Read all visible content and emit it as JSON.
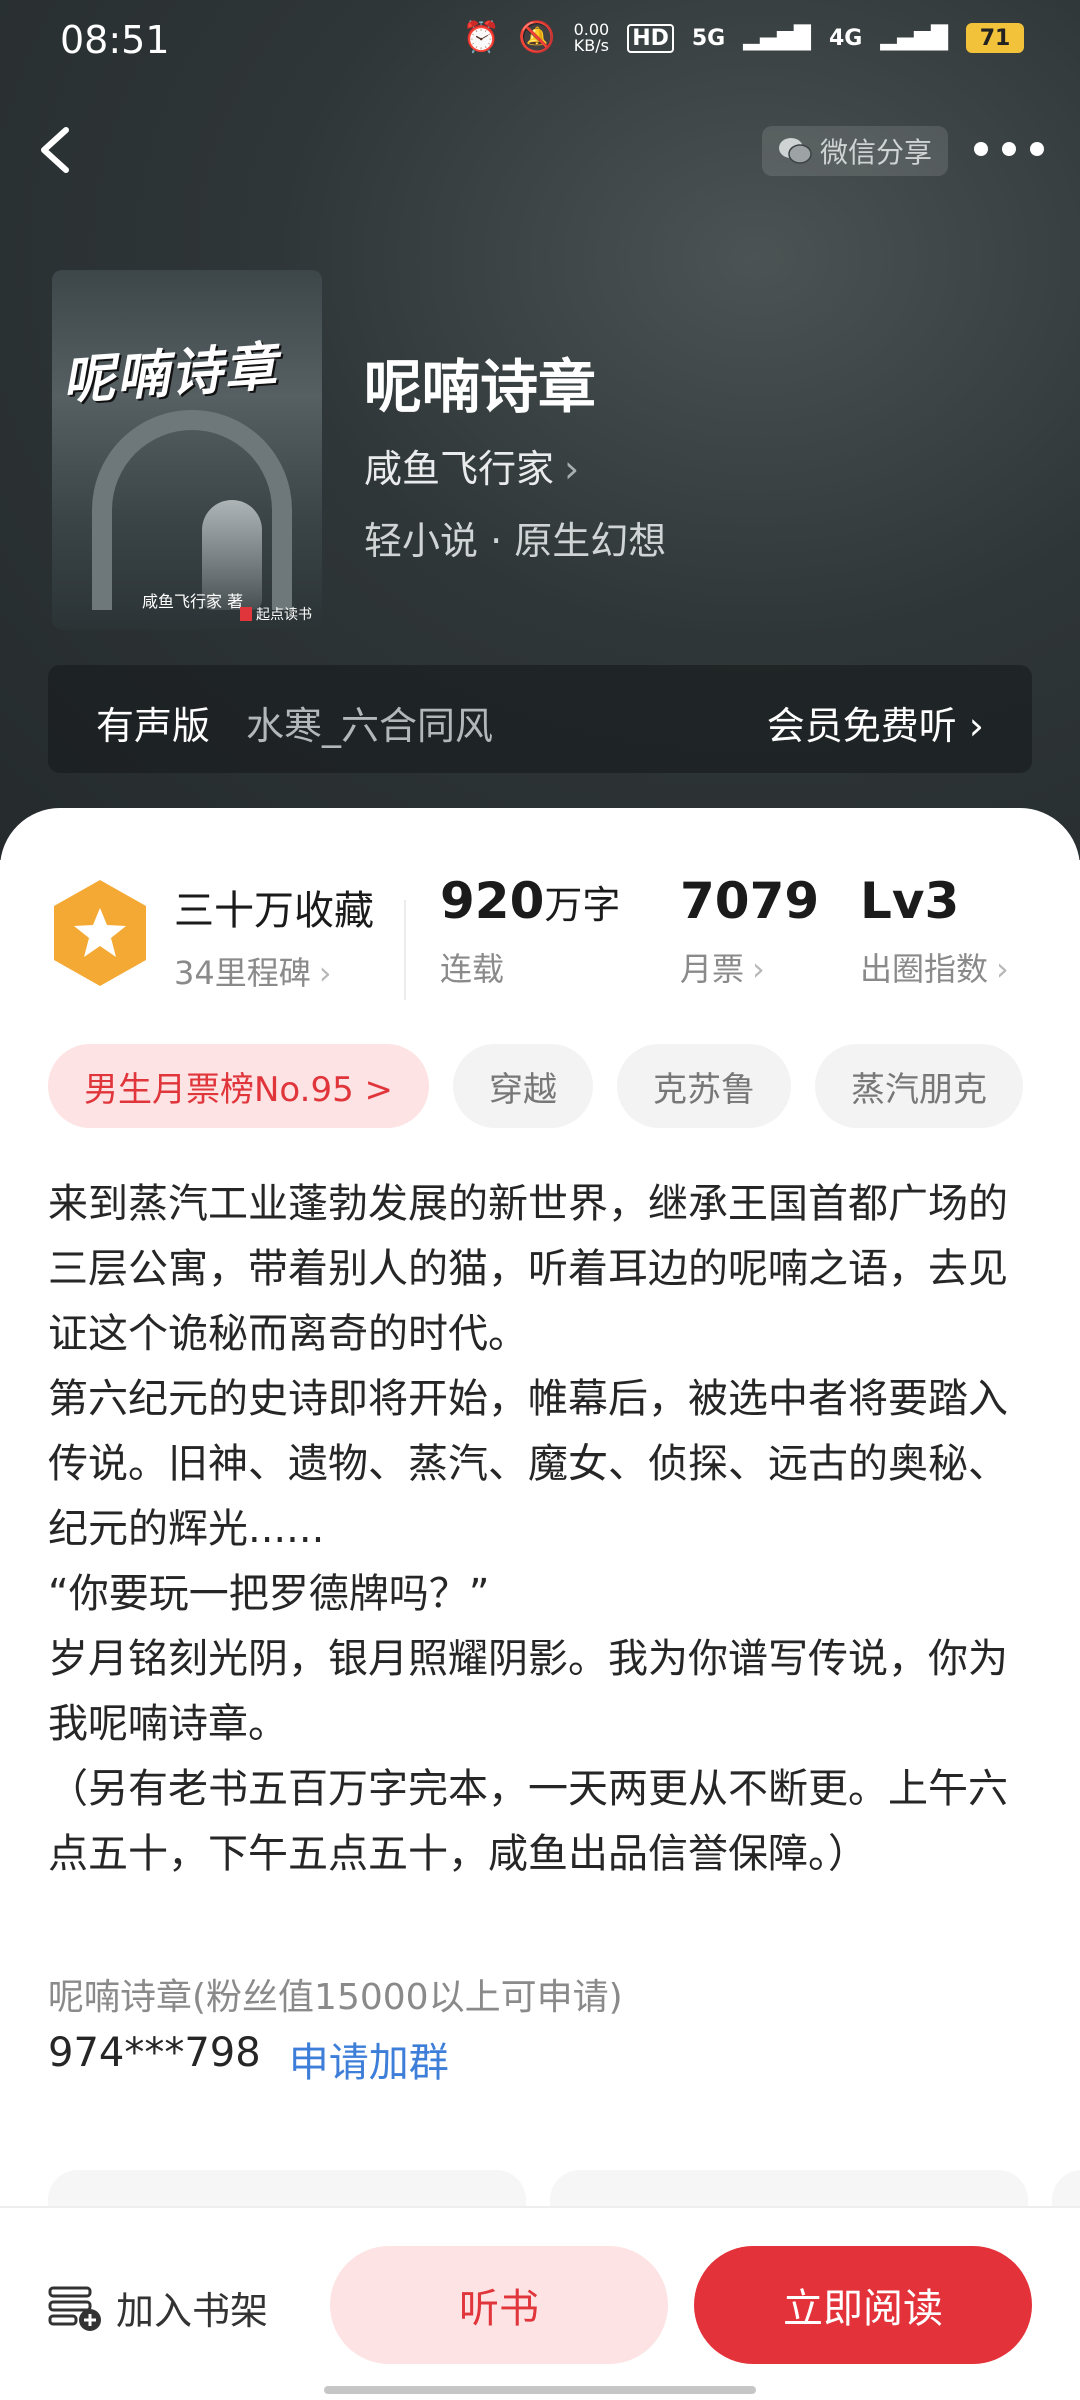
{
  "status_bar": {
    "time": "08:51",
    "net_speed_value": "0.00",
    "net_speed_unit": "KB/s",
    "hd_label": "HD",
    "signal_1": "5G",
    "signal_2": "4G",
    "battery": "71"
  },
  "nav": {
    "share_label": "微信分享"
  },
  "book": {
    "cover_title": "呢喃诗章",
    "cover_author": "咸鱼飞行家 著",
    "cover_publisher": "起点读书",
    "title": "呢喃诗章",
    "author": "咸鱼飞行家",
    "genre": "轻小说 · 原生幻想"
  },
  "audio": {
    "label": "有声版",
    "narrator": "水寒_六合同风",
    "action": "会员免费听"
  },
  "stats": {
    "favorites": "三十万收藏",
    "milestones": "34里程碑",
    "word_count": "920",
    "word_unit": "万字",
    "status": "连载",
    "monthly_votes": "7079",
    "monthly_votes_label": "月票",
    "level": "Lv3",
    "level_label": "出圈指数"
  },
  "tags": [
    {
      "label": "男生月票榜No.95 >"
    },
    {
      "label": "穿越"
    },
    {
      "label": "克苏鲁"
    },
    {
      "label": "蒸汽朋克"
    }
  ],
  "synopsis": [
    "来到蒸汽工业蓬勃发展的新世界，继承王国首都广场的三层公寓，带着别人的猫，听着耳边的呢喃之语，去见证这个诡秘而离奇的时代。",
    "第六纪元的史诗即将开始，帷幕后，被选中者将要踏入传说。旧神、遗物、蒸汽、魔女、侦探、远古的奥秘、纪元的辉光......",
    "“你要玩一把罗德牌吗？”",
    "岁月铭刻光阴，银月照耀阴影。我为你谱写传说，你为我呢喃诗章。",
    "（另有老书五百万字完本，一天两更从不断更。上午六点五十，下午五点五十，咸鱼出品信誉保障。）"
  ],
  "fan_group": {
    "label": "呢喃诗章(粉丝值15000以上可申请)",
    "number": "974***798",
    "apply": "申请加群"
  },
  "bottom": {
    "shelf": "加入书架",
    "listen": "听书",
    "read": "立即阅读"
  }
}
